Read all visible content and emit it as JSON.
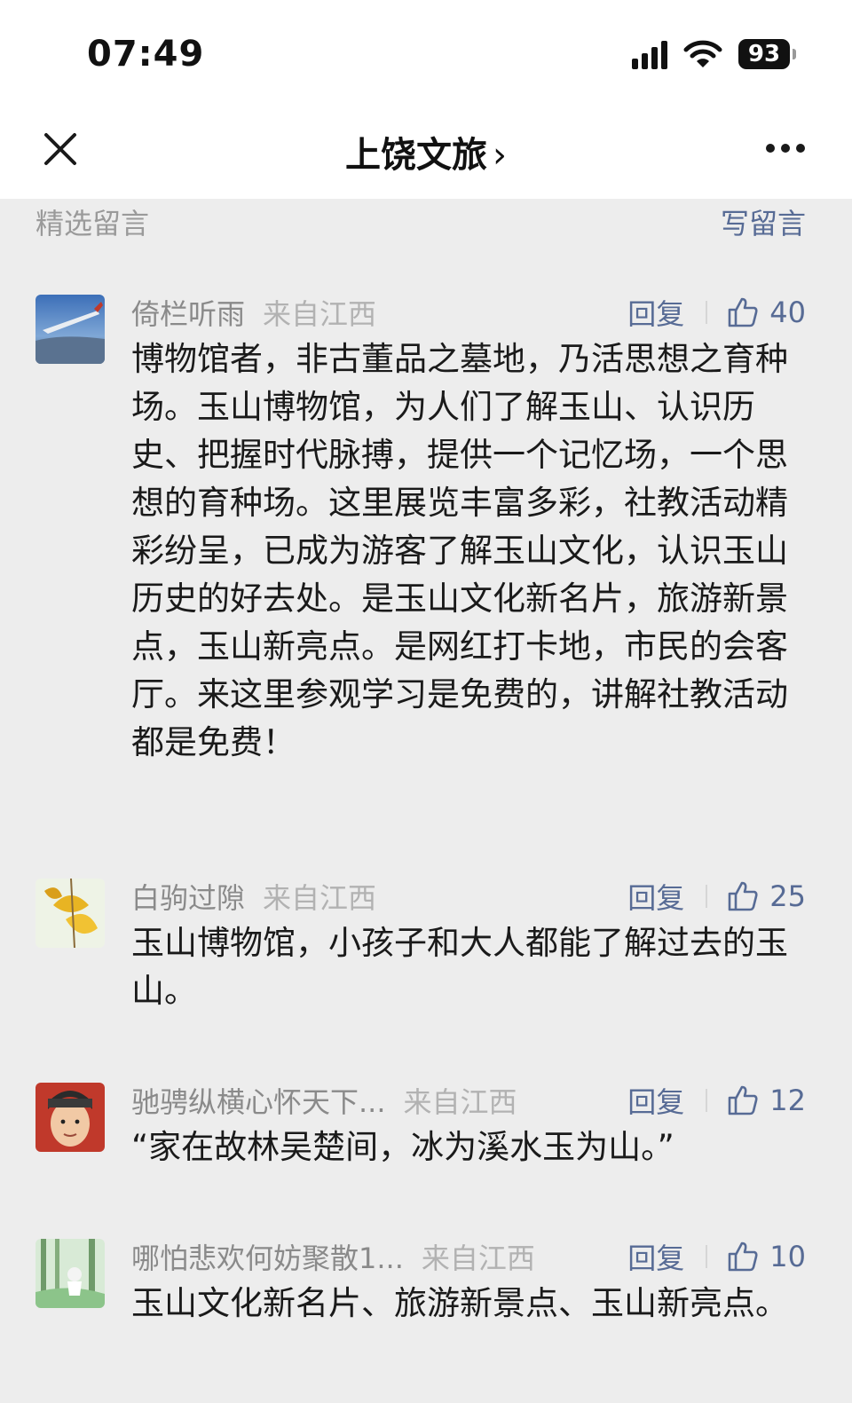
{
  "status_bar": {
    "time": "07:49",
    "battery": "93"
  },
  "nav": {
    "title": "上饶文旅",
    "chevron": "›"
  },
  "section": {
    "title": "精选留言",
    "write_label": "写留言"
  },
  "comments": [
    {
      "name": "倚栏听雨",
      "location": "来自江西",
      "reply_label": "回复",
      "likes": "40",
      "text": "博物馆者，非古董品之墓地，乃活思想之育种场。玉山博物馆，为人们了解玉山、认识历史、把握时代脉搏，提供一个记忆场，一个思想的育种场。这里展览丰富多彩，社教活动精彩纷呈，已成为游客了解玉山文化，认识玉山历史的好去处。是玉山文化新名片，旅游新景点，玉山新亮点。是网红打卡地，市民的会客厅。来这里参观学习是免费的，讲解社教活动都是免费！"
    },
    {
      "name": "白驹过隙",
      "location": "来自江西",
      "reply_label": "回复",
      "likes": "25",
      "text": "玉山博物馆，小孩子和大人都能了解过去的玉山。"
    },
    {
      "name": "驰骋纵横心怀天下...",
      "location": "来自江西",
      "reply_label": "回复",
      "likes": "12",
      "text": "“家在故林吴楚间，冰为溪水玉为山。”"
    },
    {
      "name": "哪怕悲欢何妨聚散1...",
      "location": "来自江西",
      "reply_label": "回复",
      "likes": "10",
      "text": "玉山文化新名片、旅游新景点、玉山新亮点。"
    }
  ],
  "colors": {
    "link": "#576b95",
    "background": "#ededed",
    "name": "#8a8a8a",
    "body_text": "#1a1a1a"
  }
}
